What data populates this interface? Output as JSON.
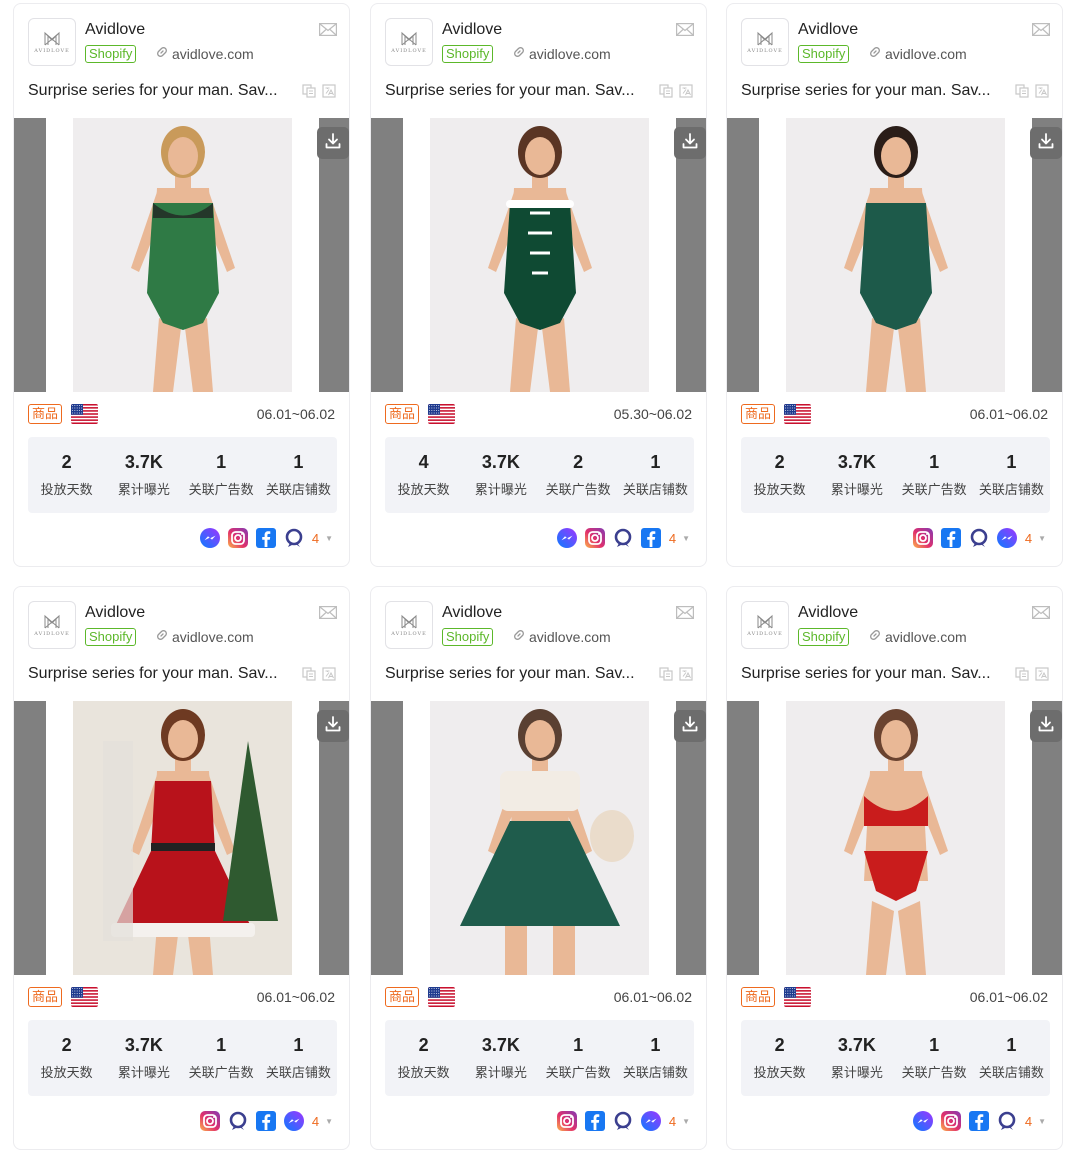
{
  "cards": [
    {
      "brand": "Avidlove",
      "platform": "Shopify",
      "domain": "avidlove.com",
      "logo_text": "AVIDLOVE",
      "description": "Surprise series for your man. Sav...",
      "tag": "商品",
      "country": "US",
      "date_range": "06.01~06.02",
      "stats": [
        {
          "value": "2",
          "label": "投放天数"
        },
        {
          "value": "3.7K",
          "label": "累计曝光"
        },
        {
          "value": "1",
          "label": "关联广告数"
        },
        {
          "value": "1",
          "label": "关联店铺数"
        }
      ],
      "social_icons": [
        "messenger-icon",
        "instagram-icon",
        "facebook-icon",
        "audience-network-icon"
      ],
      "platform_count": "4",
      "image": {
        "subject": "green camisole and lace shorts set",
        "color": "#2f7a45"
      }
    },
    {
      "brand": "Avidlove",
      "platform": "Shopify",
      "domain": "avidlove.com",
      "logo_text": "AVIDLOVE",
      "description": "Surprise series for your man. Sav...",
      "tag": "商品",
      "country": "US",
      "date_range": "05.30~06.02",
      "stats": [
        {
          "value": "4",
          "label": "投放天数"
        },
        {
          "value": "3.7K",
          "label": "累计曝光"
        },
        {
          "value": "2",
          "label": "关联广告数"
        },
        {
          "value": "1",
          "label": "关联店铺数"
        }
      ],
      "social_icons": [
        "messenger-icon",
        "instagram-icon",
        "audience-network-icon",
        "facebook-icon"
      ],
      "platform_count": "4",
      "image": {
        "subject": "green velvet lace-up bodysuit with white trim",
        "color": "#0f4a33"
      }
    },
    {
      "brand": "Avidlove",
      "platform": "Shopify",
      "domain": "avidlove.com",
      "logo_text": "AVIDLOVE",
      "description": "Surprise series for your man. Sav...",
      "tag": "商品",
      "country": "US",
      "date_range": "06.01~06.02",
      "stats": [
        {
          "value": "2",
          "label": "投放天数"
        },
        {
          "value": "3.7K",
          "label": "累计曝光"
        },
        {
          "value": "1",
          "label": "关联广告数"
        },
        {
          "value": "1",
          "label": "关联店铺数"
        }
      ],
      "social_icons": [
        "instagram-icon",
        "facebook-icon",
        "audience-network-icon",
        "messenger-icon"
      ],
      "platform_count": "4",
      "image": {
        "subject": "green lace bodysuit",
        "color": "#1d5a4a"
      }
    },
    {
      "brand": "Avidlove",
      "platform": "Shopify",
      "domain": "avidlove.com",
      "logo_text": "AVIDLOVE",
      "description": "Surprise series for your man. Sav...",
      "tag": "商品",
      "country": "US",
      "date_range": "06.01~06.02",
      "stats": [
        {
          "value": "2",
          "label": "投放天数"
        },
        {
          "value": "3.7K",
          "label": "累计曝光"
        },
        {
          "value": "1",
          "label": "关联广告数"
        },
        {
          "value": "1",
          "label": "关联店铺数"
        }
      ],
      "social_icons": [
        "instagram-icon",
        "audience-network-icon",
        "facebook-icon",
        "messenger-icon"
      ],
      "platform_count": "4",
      "image": {
        "subject": "red velvet christmas dress",
        "color": "#b8121b"
      }
    },
    {
      "brand": "Avidlove",
      "platform": "Shopify",
      "domain": "avidlove.com",
      "logo_text": "AVIDLOVE",
      "description": "Surprise series for your man. Sav...",
      "tag": "商品",
      "country": "US",
      "date_range": "06.01~06.02",
      "stats": [
        {
          "value": "2",
          "label": "投放天数"
        },
        {
          "value": "3.7K",
          "label": "累计曝光"
        },
        {
          "value": "1",
          "label": "关联广告数"
        },
        {
          "value": "1",
          "label": "关联店铺数"
        }
      ],
      "social_icons": [
        "instagram-icon",
        "facebook-icon",
        "audience-network-icon",
        "messenger-icon"
      ],
      "platform_count": "4",
      "image": {
        "subject": "green flared mini skirt",
        "color": "#1f5c4c"
      }
    },
    {
      "brand": "Avidlove",
      "platform": "Shopify",
      "domain": "avidlove.com",
      "logo_text": "AVIDLOVE",
      "description": "Surprise series for your man. Sav...",
      "tag": "商品",
      "country": "US",
      "date_range": "06.01~06.02",
      "stats": [
        {
          "value": "2",
          "label": "投放天数"
        },
        {
          "value": "3.7K",
          "label": "累计曝光"
        },
        {
          "value": "1",
          "label": "关联广告数"
        },
        {
          "value": "1",
          "label": "关联店铺数"
        }
      ],
      "social_icons": [
        "messenger-icon",
        "instagram-icon",
        "facebook-icon",
        "audience-network-icon"
      ],
      "platform_count": "4",
      "image": {
        "subject": "red lace bra and panty set",
        "color": "#c91c1c"
      }
    }
  ]
}
